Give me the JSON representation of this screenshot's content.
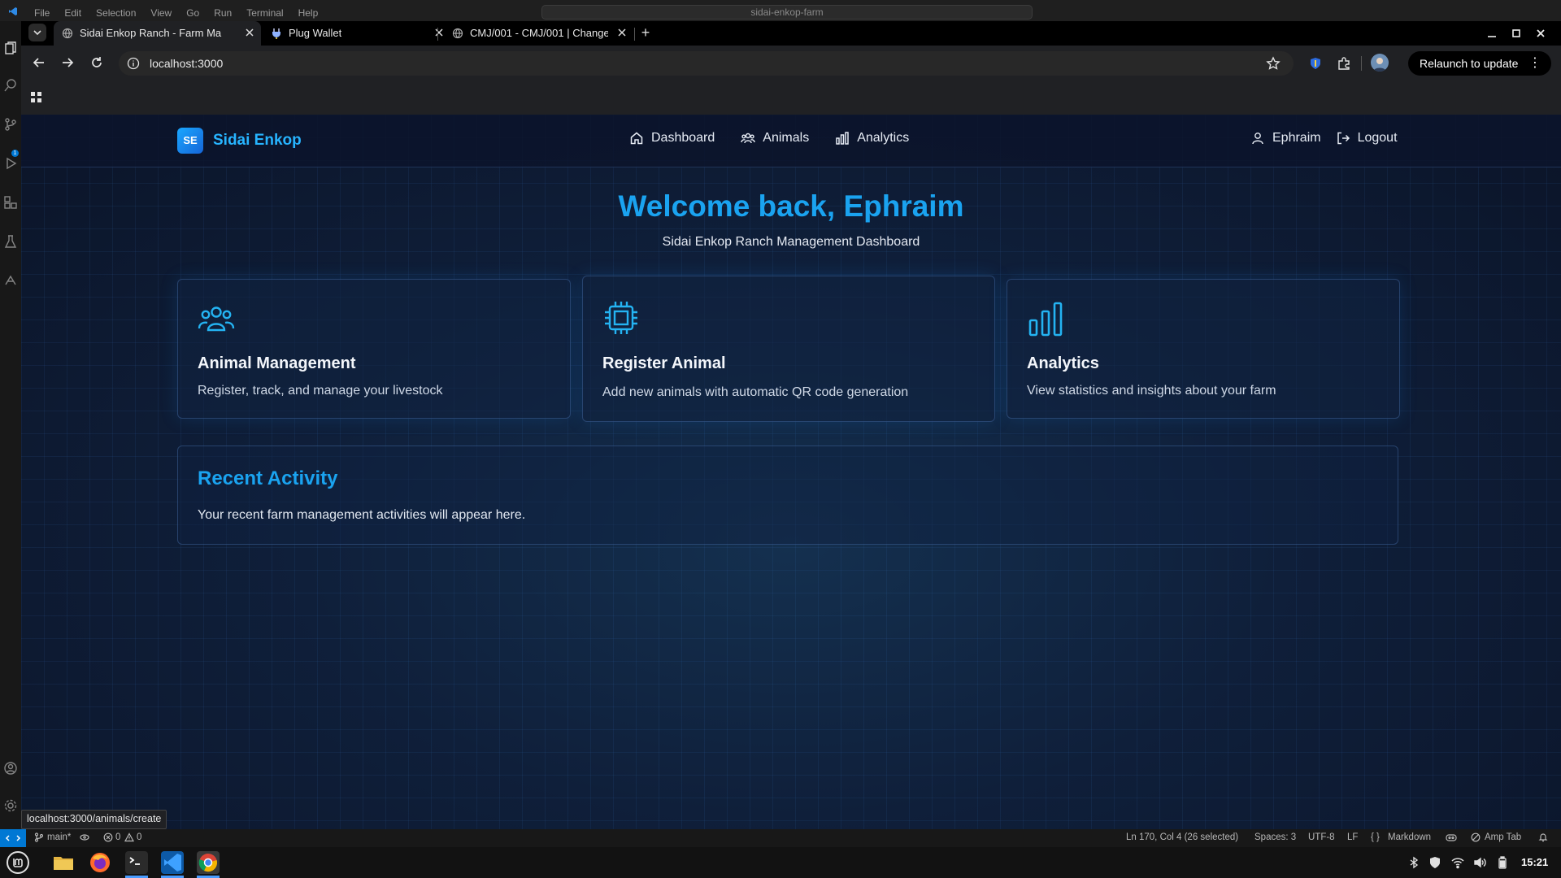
{
  "vscode": {
    "menu": [
      "File",
      "Edit",
      "Selection",
      "View",
      "Go",
      "Run",
      "Terminal",
      "Help"
    ],
    "search_text": "sidai-enkop-farm",
    "activity_badge": "1",
    "status": {
      "branch": "main*",
      "errors": "0",
      "warnings": "0",
      "cursor": "Ln 170, Col 4 (26 selected)",
      "spaces": "Spaces: 3",
      "encoding": "UTF-8",
      "eol": "LF",
      "language": "Markdown",
      "amp": "Amp Tab"
    }
  },
  "browser": {
    "tabs": [
      {
        "title": "Sidai Enkop Ranch - Farm Ma",
        "active": true
      },
      {
        "title": "Plug Wallet",
        "active": false
      },
      {
        "title": "CMJ/001 - CMJ/001 | Change",
        "active": false
      }
    ],
    "url": "localhost:3000",
    "relaunch_label": "Relaunch to update",
    "hover_url": "localhost:3000/animals/create"
  },
  "app": {
    "brand": {
      "logo": "SE",
      "name": "Sidai Enkop"
    },
    "nav": [
      {
        "label": "Dashboard",
        "icon": "home-icon"
      },
      {
        "label": "Animals",
        "icon": "users-icon"
      },
      {
        "label": "Analytics",
        "icon": "bar-chart-icon"
      }
    ],
    "user": {
      "name": "Ephraim",
      "logout": "Logout"
    },
    "hero": {
      "title": "Welcome back, Ephraim",
      "subtitle": "Sidai Enkop Ranch Management Dashboard"
    },
    "cards": [
      {
        "title": "Animal Management",
        "desc": "Register, track, and manage your livestock",
        "icon": "users-icon"
      },
      {
        "title": "Register Animal",
        "desc": "Add new animals with automatic QR code generation",
        "icon": "chip-icon"
      },
      {
        "title": "Analytics",
        "desc": "View statistics and insights about your farm",
        "icon": "bar-chart-icon"
      }
    ],
    "recent": {
      "title": "Recent Activity",
      "text": "Your recent farm management activities will appear here."
    }
  },
  "taskbar": {
    "clock": "15:21",
    "apps": [
      "mint-menu-icon",
      "files-icon",
      "firefox-icon",
      "terminal-icon",
      "vscode-icon",
      "chrome-icon"
    ]
  },
  "colors": {
    "accent": "#1aa3f0",
    "page_bg": "#0f1f3a",
    "chrome_bg": "#202124"
  }
}
